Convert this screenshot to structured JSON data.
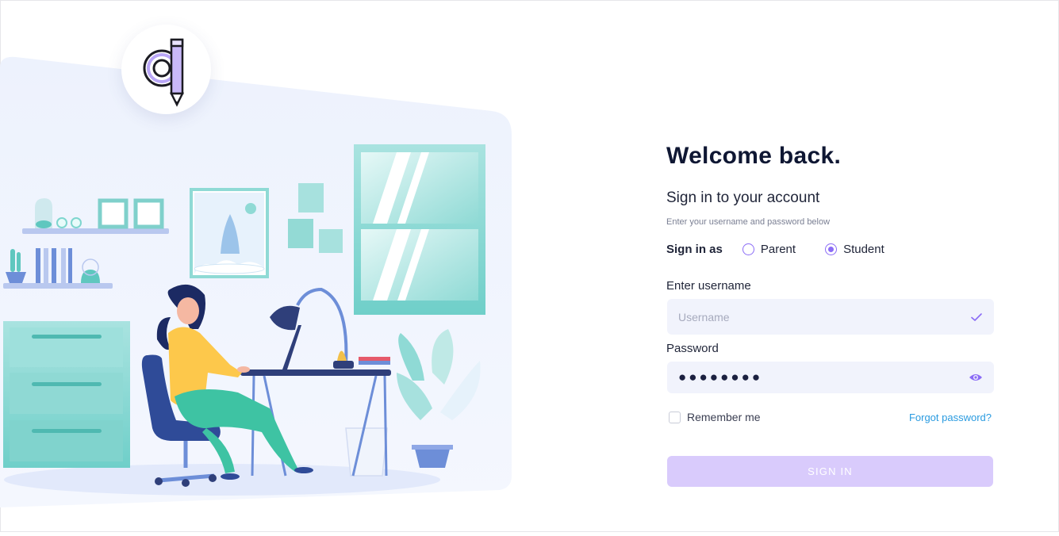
{
  "form": {
    "title": "Welcome back.",
    "subtitle": "Sign in to your account",
    "helper": "Enter your username and password below",
    "sign_in_as_label": "Sign in as",
    "roles": [
      {
        "label": "Parent",
        "selected": false
      },
      {
        "label": "Student",
        "selected": true
      }
    ],
    "username_label": "Enter username",
    "username_placeholder": "Username",
    "username_value": "",
    "password_label": "Password",
    "password_value": "●●●●●●●●",
    "remember_label": "Remember me",
    "remember_checked": false,
    "forgot_label": "Forgot password?",
    "submit_label": "SIGN IN"
  },
  "icons": {
    "logo": "pencil-q-logo",
    "username_status": "check-icon",
    "password_toggle": "eye-icon"
  },
  "colors": {
    "accent": "#8b6cf6",
    "button_disabled": "#d9cbfc",
    "link": "#2a9be0",
    "input_bg": "#f1f3fc",
    "heading": "#0f1733"
  }
}
